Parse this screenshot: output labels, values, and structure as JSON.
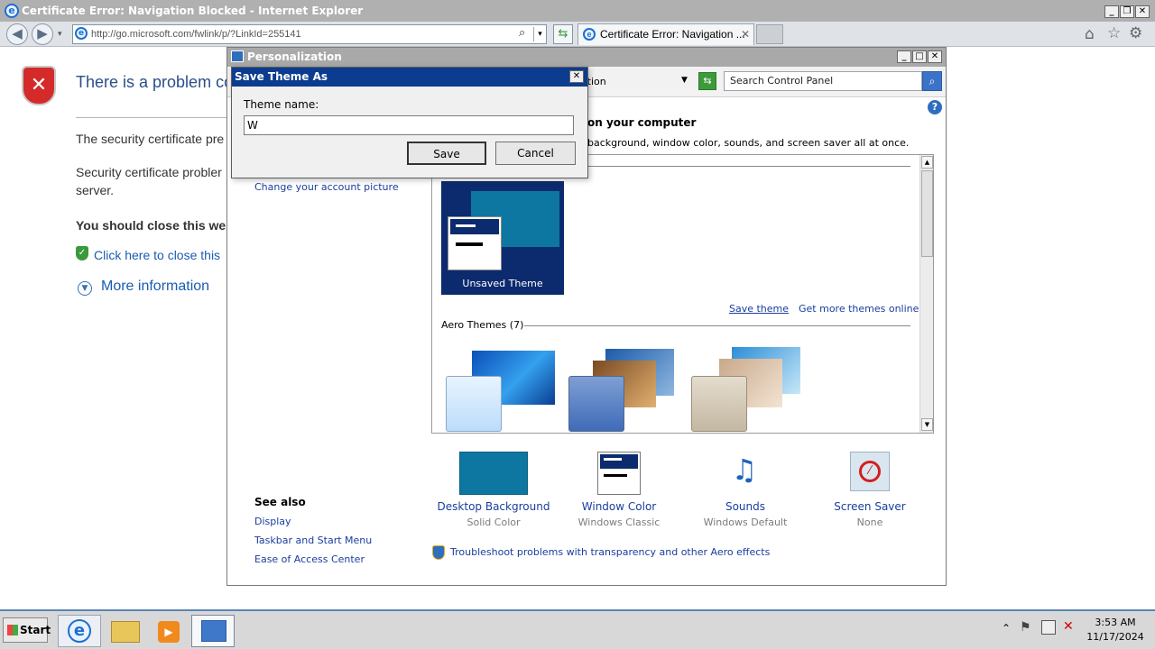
{
  "ie": {
    "title": "Certificate Error: Navigation Blocked - Internet Explorer",
    "url": "http://go.microsoft.com/fwlink/p/?LinkId=255141",
    "tab_label": "Certificate Error: Navigation ...",
    "error": {
      "heading": "There is a problem co",
      "line1": "The security certificate pre",
      "line2": "Security certificate probler",
      "line2b": "server.",
      "bold": "You should close this we",
      "close_link": "Click here to close this",
      "more_info": "More information"
    }
  },
  "personalization": {
    "title": "Personalization",
    "breadcrumb": "lization",
    "search_placeholder": "Search Control Panel",
    "heading": "on your computer",
    "description": "background, window color, sounds, and screen saver all at once.",
    "left_link": "Change your account picture",
    "unsaved_theme": "Unsaved Theme",
    "save_theme": "Save theme",
    "get_more": "Get more themes online",
    "aero_themes": "Aero Themes (7)",
    "see_also": "See also",
    "see_also_links": [
      "Display",
      "Taskbar and Start Menu",
      "Ease of Access Center"
    ],
    "bottom_items": [
      {
        "label": "Desktop Background",
        "value": "Solid Color"
      },
      {
        "label": "Window Color",
        "value": "Windows Classic"
      },
      {
        "label": "Sounds",
        "value": "Windows Default"
      },
      {
        "label": "Screen Saver",
        "value": "None"
      }
    ],
    "troubleshoot": "Troubleshoot problems with transparency and other Aero effects"
  },
  "dialog": {
    "title": "Save Theme As",
    "field_label": "Theme name:",
    "field_value": "W",
    "save_label": "Save",
    "cancel_label": "Cancel"
  },
  "taskbar": {
    "start_label": "Start",
    "time": "3:53 AM",
    "date": "11/17/2024"
  },
  "colors": {
    "accent_blue": "#0c3c8f",
    "link_blue": "#1a3e9e",
    "error_red": "#d42a2a",
    "desktop_bg": "#0e77a1"
  }
}
